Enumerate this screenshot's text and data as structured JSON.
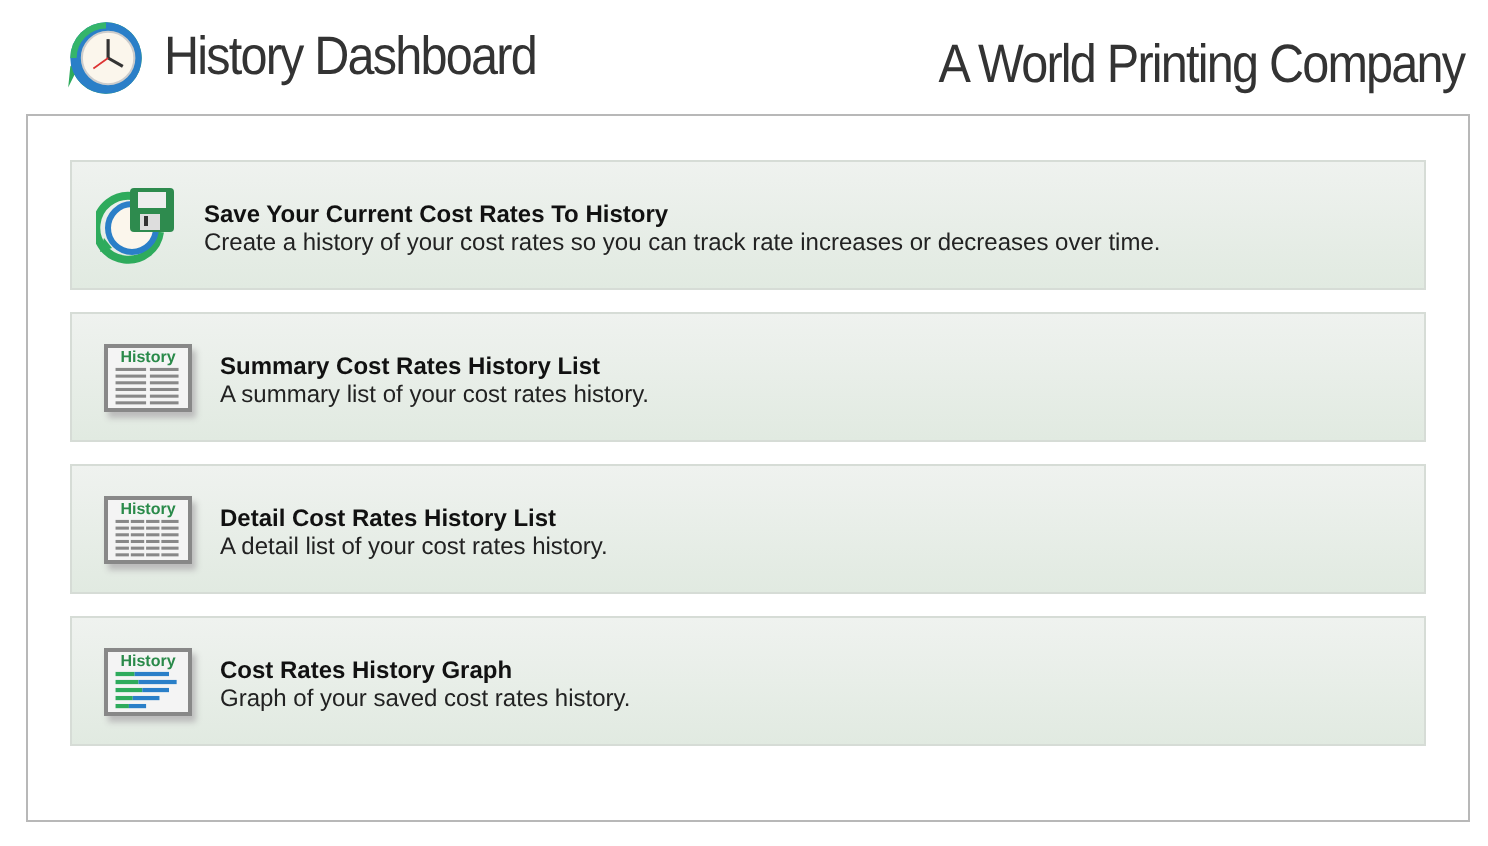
{
  "header": {
    "title": "History Dashboard",
    "company": "A World Printing Company"
  },
  "items": [
    {
      "kind": "save",
      "title": "Save Your Current Cost Rates To History",
      "description": "Create a history of your cost rates so you can track rate increases or decreases over time."
    },
    {
      "kind": "summary",
      "icon_label": "History",
      "title": "Summary Cost Rates History List",
      "description": "A summary list of your cost rates history."
    },
    {
      "kind": "detail",
      "icon_label": "History",
      "title": "Detail Cost Rates History List",
      "description": "A detail list of your cost rates history."
    },
    {
      "kind": "graph",
      "icon_label": "History",
      "title": "Cost Rates History Graph",
      "description": "Graph of your saved cost rates history."
    }
  ]
}
